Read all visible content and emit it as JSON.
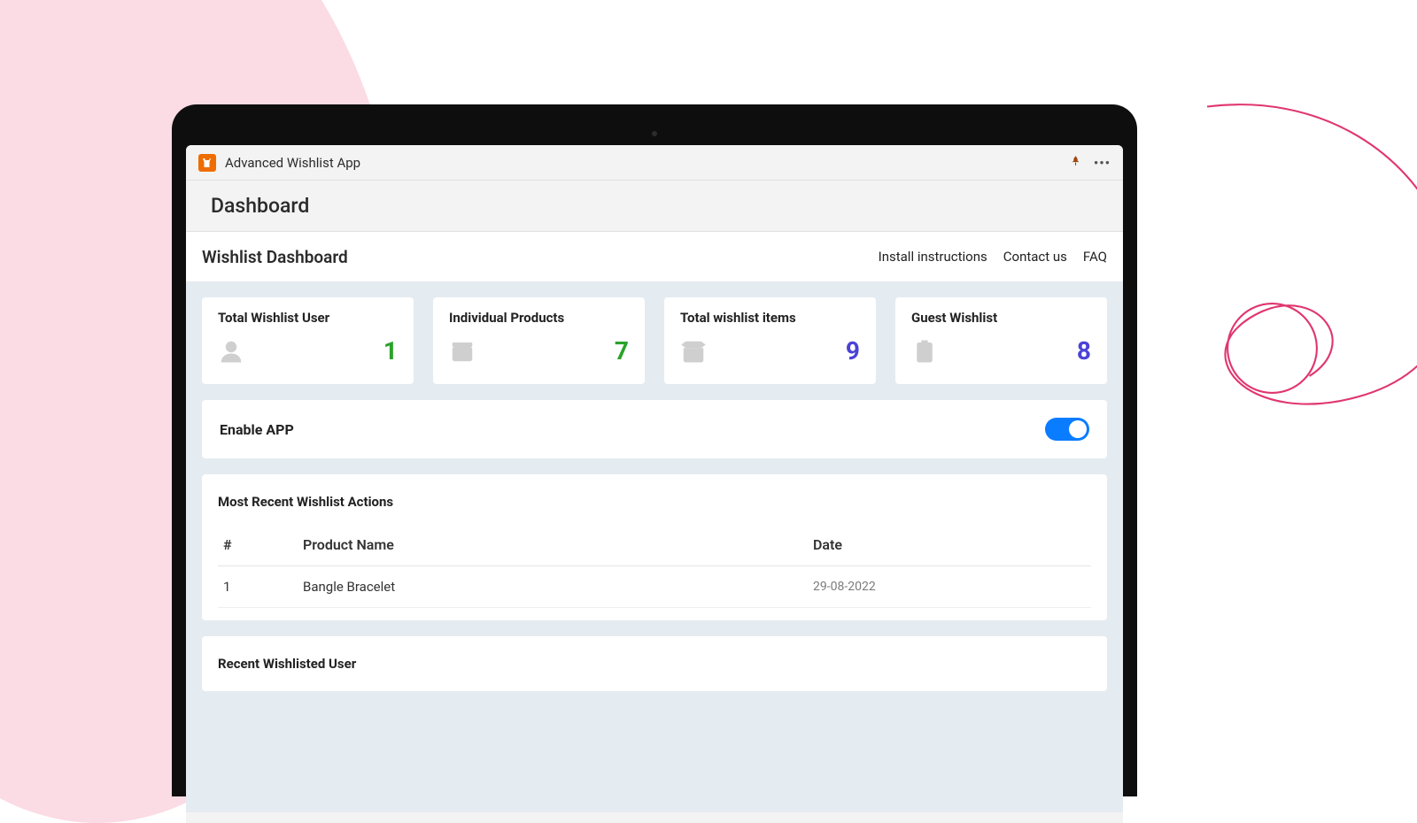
{
  "topbar": {
    "app_title": "Advanced Wishlist App"
  },
  "page": {
    "title": "Dashboard",
    "subtitle": "Wishlist Dashboard"
  },
  "nav_links": {
    "install": "Install instructions",
    "contact": "Contact us",
    "faq": "FAQ"
  },
  "stats": [
    {
      "label": "Total Wishlist User",
      "value": "1",
      "color": "green",
      "icon": "user"
    },
    {
      "label": "Individual Products",
      "value": "7",
      "color": "green",
      "icon": "box"
    },
    {
      "label": "Total wishlist items",
      "value": "9",
      "color": "purple",
      "icon": "openbox"
    },
    {
      "label": "Guest Wishlist",
      "value": "8",
      "color": "purple",
      "icon": "clipboard"
    }
  ],
  "enable_panel": {
    "label": "Enable APP",
    "state": true
  },
  "recent_actions": {
    "title": "Most Recent Wishlist Actions",
    "columns": {
      "idx": "#",
      "product": "Product Name",
      "date": "Date"
    },
    "rows": [
      {
        "idx": "1",
        "product": "Bangle Bracelet",
        "date": "29-08-2022"
      }
    ]
  },
  "recent_users": {
    "title": "Recent Wishlisted User"
  }
}
